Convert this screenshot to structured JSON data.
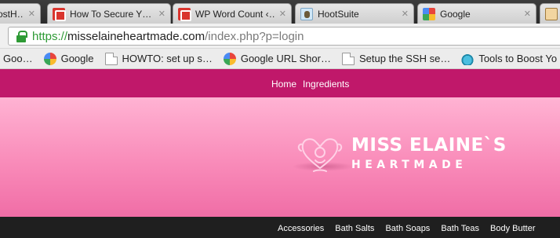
{
  "browser": {
    "tabs": [
      {
        "title": "ostH…",
        "icon": "hootsuite-icon"
      },
      {
        "title": "How To Secure Y…",
        "icon": "blogger-icon"
      },
      {
        "title": "WP Word Count ‹…",
        "icon": "blogger-icon"
      },
      {
        "title": "HootSuite",
        "icon": "hootsuite-icon"
      },
      {
        "title": "Google",
        "icon": "google-icon"
      },
      {
        "title": "",
        "icon": "notebook-icon"
      }
    ],
    "tab_close_glyph": "✕",
    "address": {
      "scheme": "https://",
      "host": "misselaineheartmade.com",
      "rest": "/index.php?p=login"
    },
    "bookmarks": [
      {
        "label": "Goo…",
        "icon": ""
      },
      {
        "label": "Google",
        "icon": "google-icon"
      },
      {
        "label": "HOWTO: set up s…",
        "icon": "page-icon"
      },
      {
        "label": "Google URL Shor…",
        "icon": "google-icon"
      },
      {
        "label": "Setup the SSH se…",
        "icon": "page-icon"
      },
      {
        "label": "Tools to Boost Yo",
        "icon": "drop-icon"
      }
    ]
  },
  "site": {
    "nav": {
      "home": "Home",
      "ingredients": "Ingredients"
    },
    "logo": {
      "name": "MISS ELAINE`S",
      "sub": "HEARTMADE"
    },
    "categories": [
      "Accessories",
      "Bath Salts",
      "Bath Soaps",
      "Bath Teas",
      "Body Butter"
    ]
  },
  "colors": {
    "nav_bg": "#c0186a",
    "banner_top": "#ffb3d3",
    "banner_bottom": "#f06da6",
    "catbar_bg": "#1f1f1f",
    "secure_green": "#2e9a35"
  }
}
